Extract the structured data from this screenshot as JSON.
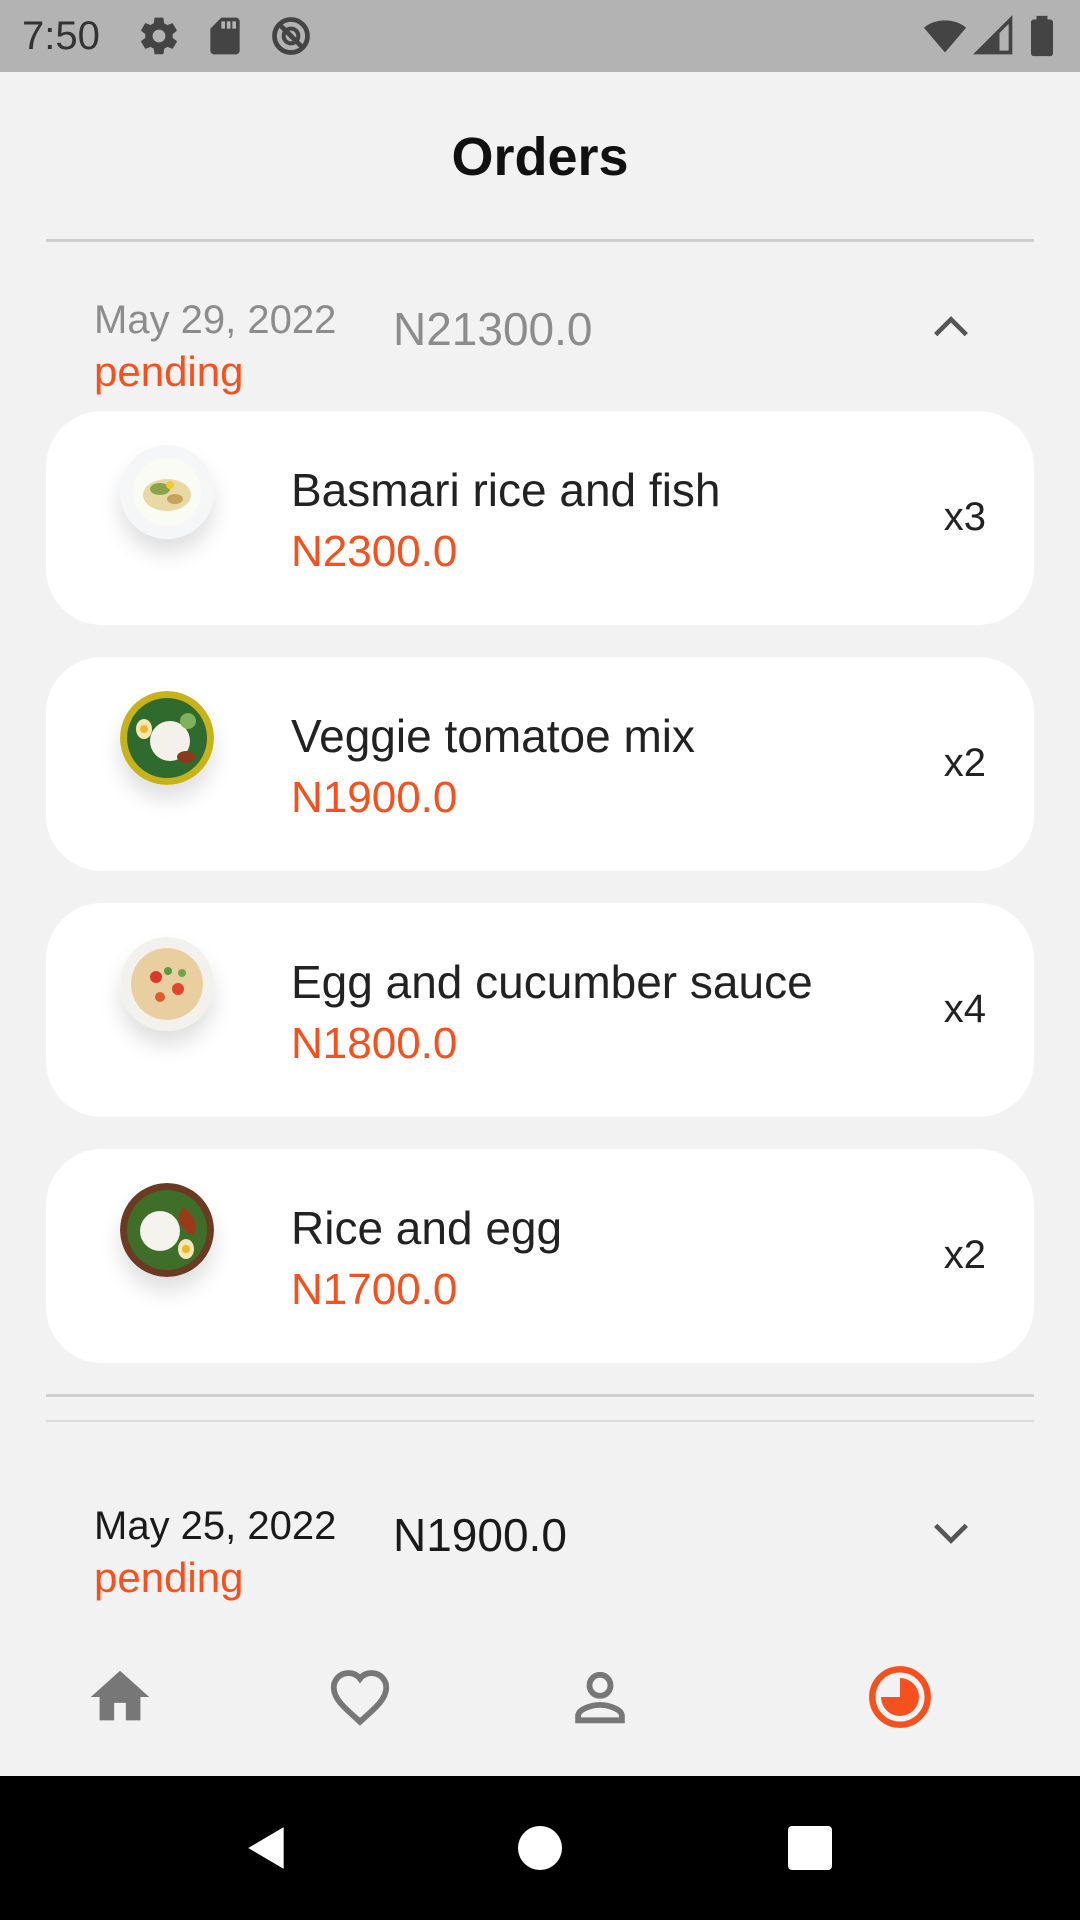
{
  "status_bar": {
    "time": "7:50",
    "left_icons": [
      "gear-icon",
      "sd-card-icon",
      "no-sync-icon"
    ],
    "right_icons": [
      "wifi-icon",
      "cell-signal-icon",
      "battery-icon"
    ]
  },
  "page": {
    "title": "Orders"
  },
  "colors": {
    "accent": "#f4511e",
    "muted_text": "#8c8c8c",
    "card_bg": "#ffffff",
    "page_bg": "#f2f2f2"
  },
  "orders": [
    {
      "date": "May 29, 2022",
      "status": "pending",
      "total": "N21300.0",
      "expanded": true,
      "items": [
        {
          "name": "Basmari rice and fish",
          "price": "N2300.0",
          "qty": "x3"
        },
        {
          "name": "Veggie tomatoe mix",
          "price": "N1900.0",
          "qty": "x2"
        },
        {
          "name": "Egg and cucumber sauce",
          "price": "N1800.0",
          "qty": "x4"
        },
        {
          "name": "Rice and egg",
          "price": "N1700.0",
          "qty": "x2"
        }
      ]
    },
    {
      "date": "May 25, 2022",
      "status": "pending",
      "total": "N1900.0",
      "expanded": false
    }
  ],
  "bottom_nav": {
    "items": [
      "home-icon",
      "favorites-icon",
      "profile-icon",
      "orders-history-icon"
    ],
    "active": "orders-history-icon"
  },
  "system_nav": [
    "back-icon",
    "home-button-icon",
    "recents-icon"
  ]
}
